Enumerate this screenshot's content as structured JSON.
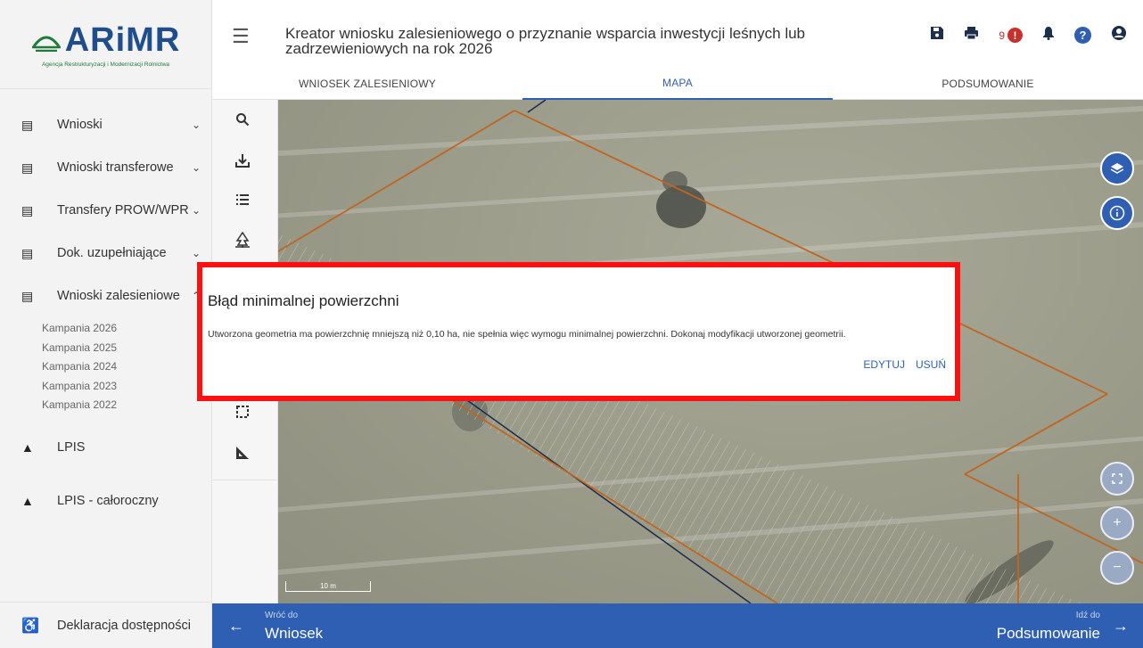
{
  "logo": {
    "name": "ARiMR",
    "subtitle": "Agencja Restrukturyzacji i Modernizacji Rolnictwa"
  },
  "sidebar": {
    "items": [
      {
        "label": "Wnioski",
        "icon": "clipboard-icon",
        "chevron": "down"
      },
      {
        "label": "Wnioski transferowe",
        "icon": "clipboard-icon",
        "chevron": "down"
      },
      {
        "label": "Transfery PROW/WPR",
        "icon": "clipboard-icon",
        "chevron": "down"
      },
      {
        "label": "Dok. uzupełniające",
        "icon": "clipboard-icon",
        "chevron": "down"
      },
      {
        "label": "Wnioski zalesieniowe",
        "icon": "clipboard-icon",
        "chevron": "up"
      }
    ],
    "subitems": [
      "Kampania 2026",
      "Kampania 2025",
      "Kampania 2024",
      "Kampania 2023",
      "Kampania 2022"
    ],
    "extra_items": [
      {
        "label": "LPIS",
        "icon": "mountain-icon"
      },
      {
        "label": "LPIS - całoroczny",
        "icon": "mountain-icon"
      }
    ],
    "footer": {
      "label": "Deklaracja dostępności",
      "icon": "accessibility-icon"
    }
  },
  "header": {
    "title": "Kreator wniosku zalesieniowego o przyznanie wsparcia inwestycji leśnych lub zadrzewieniowych na rok 2026",
    "notification_count": "9"
  },
  "tabs": [
    {
      "label": "WNIOSEK ZALESIENIOWY",
      "active": false
    },
    {
      "label": "MAPA",
      "active": true
    },
    {
      "label": "PODSUMOWANIE",
      "active": false
    }
  ],
  "map": {
    "scale_label": "10 m"
  },
  "dialog": {
    "title": "Błąd minimalnej powierzchni",
    "message": "Utworzona geometria ma powierzchnię mniejszą niż 0,10 ha, nie spełnia więc wymogu minimalnej powierzchni. Dokonaj modyfikacji utworzonej geometrii.",
    "edit_label": "EDYTUJ",
    "delete_label": "USUŃ"
  },
  "bottom_nav": {
    "back_small": "Wróć do",
    "back_big": "Wniosek",
    "next_small": "Idź do",
    "next_big": "Podsumowanie"
  },
  "colors": {
    "primary": "#2f5fb3",
    "error": "#c9302c",
    "highlight_frame": "#ff1010",
    "parcel_line": "#c0651f"
  }
}
